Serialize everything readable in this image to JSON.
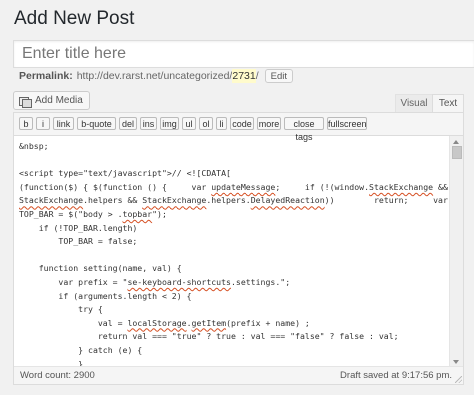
{
  "page": {
    "title": "Add New Post"
  },
  "title_field": {
    "placeholder": "Enter title here",
    "value": ""
  },
  "permalink": {
    "label": "Permalink:",
    "url_prefix": "http://dev.rarst.net/uncategorized/",
    "slug": "2731",
    "url_suffix": "/",
    "edit_label": "Edit"
  },
  "media": {
    "add_label": "Add Media",
    "icon": "add-media-icon"
  },
  "editor_tabs": {
    "visual": "Visual",
    "text": "Text",
    "active": "Text"
  },
  "quicktags": [
    "b",
    "i",
    "link",
    "b-quote",
    "del",
    "ins",
    "img",
    "ul",
    "ol",
    "li",
    "code",
    "more",
    "close tags",
    "fullscreen"
  ],
  "code_lines": [
    "&nbsp;",
    "",
    "<script type=\"text/javascript\">// <![CDATA[",
    "(function($) { $(function () {     var updateMessage;     if (!(window.StackExchange &&",
    "StackExchange.helpers && StackExchange.helpers.DelayedReaction))        return;     var",
    "TOP_BAR = $(\"body > .topbar\");",
    "    if (!TOP_BAR.length)",
    "        TOP_BAR = false;",
    "",
    "    function setting(name, val) {",
    "        var prefix = \"se-keyboard-shortcuts.settings.\";",
    "        if (arguments.length < 2) {",
    "            try {",
    "                val = localStorage.getItem(prefix + name) ;",
    "                return val === \"true\" ? true : val === \"false\" ? false : val;",
    "            } catch (e) {",
    "            }"
  ],
  "status": {
    "word_count": "Word count: 2900",
    "draft_saved": "Draft saved at 9:17:56 pm."
  },
  "colors": {
    "background": "#f1f1f1",
    "editor_bg": "#ffffff",
    "spellcheck_underline": "#d54e21",
    "slug_highlight": "#fffbcc"
  }
}
